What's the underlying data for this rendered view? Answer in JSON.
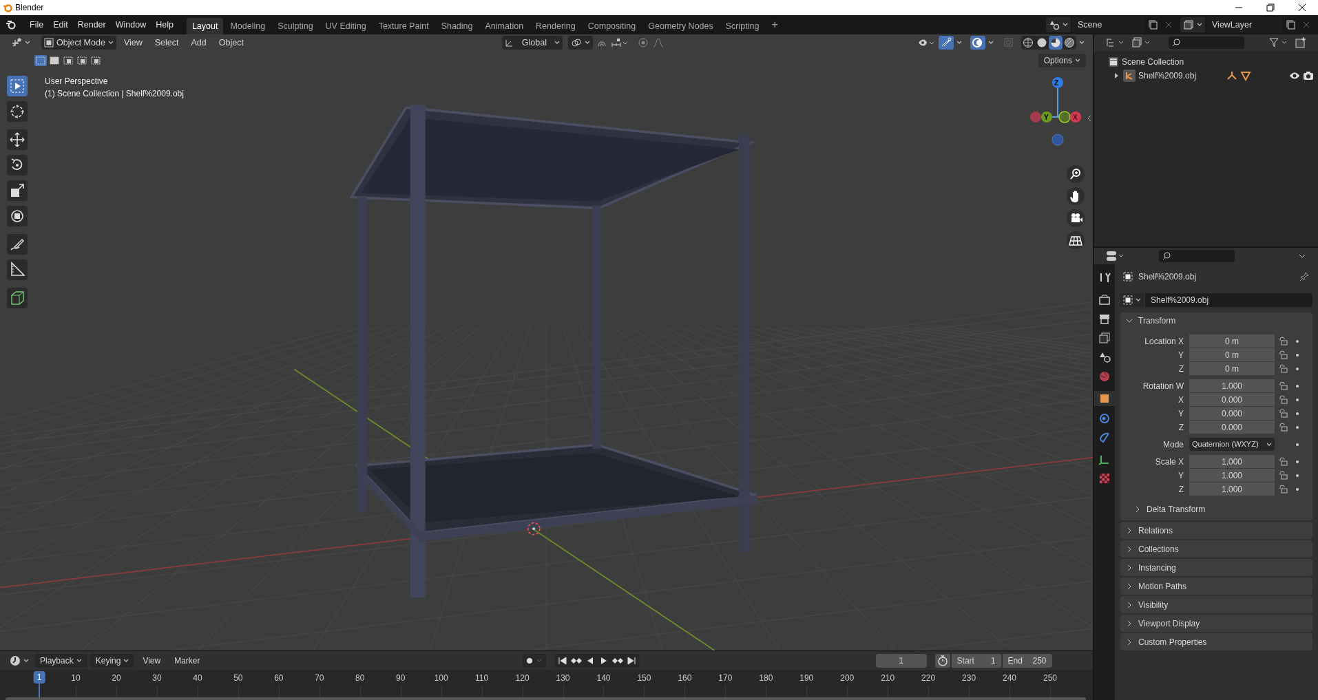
{
  "window": {
    "title": "Blender"
  },
  "menu": [
    "File",
    "Edit",
    "Render",
    "Window",
    "Help"
  ],
  "workspaces": [
    {
      "label": "Layout",
      "selected": true
    },
    {
      "label": "Modeling",
      "selected": false
    },
    {
      "label": "Sculpting",
      "selected": false
    },
    {
      "label": "UV Editing",
      "selected": false
    },
    {
      "label": "Texture Paint",
      "selected": false
    },
    {
      "label": "Shading",
      "selected": false
    },
    {
      "label": "Animation",
      "selected": false
    },
    {
      "label": "Rendering",
      "selected": false
    },
    {
      "label": "Compositing",
      "selected": false
    },
    {
      "label": "Geometry Nodes",
      "selected": false
    },
    {
      "label": "Scripting",
      "selected": false
    }
  ],
  "add_workspace": "+",
  "scene": "Scene",
  "view_layer": "ViewLayer",
  "viewport": {
    "mode": "Object Mode",
    "menus": [
      "View",
      "Select",
      "Add",
      "Object"
    ],
    "orientation": "Global",
    "options": "Options",
    "info": [
      "User Perspective",
      "(1) Scene Collection | Shelf%2009.obj"
    ],
    "tools": [
      {
        "kind": "select",
        "selected": true
      },
      {
        "kind": "cursor",
        "selected": false
      },
      {
        "kind": "move",
        "selected": false
      },
      {
        "kind": "rotate",
        "selected": false
      },
      {
        "kind": "scale",
        "selected": false
      },
      {
        "kind": "transform",
        "selected": false
      },
      {
        "kind": "annotate",
        "selected": false
      },
      {
        "kind": "measure",
        "selected": false
      },
      {
        "kind": "add_cube",
        "selected": false
      }
    ],
    "shading": [
      {
        "kind": "wireframe",
        "selected": false
      },
      {
        "kind": "solid",
        "selected": false
      },
      {
        "kind": "material",
        "selected": true
      },
      {
        "kind": "rendered",
        "selected": false
      }
    ],
    "gizmo_labels": [
      "Z",
      "Y",
      "X"
    ]
  },
  "outliner": {
    "root": "Scene Collection",
    "items": [
      {
        "label": "Shelf%2009.obj",
        "expanded": false
      }
    ]
  },
  "properties": {
    "object_name": "Shelf%2009.obj",
    "data_name": "Shelf%2009.obj",
    "tabs": [
      {
        "kind": "tool",
        "selected": false
      },
      {
        "kind": "render",
        "selected": false
      },
      {
        "kind": "output",
        "selected": false
      },
      {
        "kind": "view_layer",
        "selected": false
      },
      {
        "kind": "scene",
        "selected": false
      },
      {
        "kind": "world",
        "selected": false
      },
      {
        "kind": "object",
        "selected": true
      },
      {
        "kind": "physics",
        "selected": false
      },
      {
        "kind": "constraints",
        "selected": false
      },
      {
        "kind": "data",
        "selected": false
      },
      {
        "kind": "texture",
        "selected": false
      }
    ],
    "transform": {
      "title": "Transform",
      "expanded": true,
      "groups": [
        {
          "kind": "fields",
          "rows": [
            {
              "label": "Location X",
              "value": "0 m"
            },
            {
              "label": "Y",
              "value": "0 m"
            },
            {
              "label": "Z",
              "value": "0 m"
            }
          ]
        },
        {
          "kind": "fields",
          "rows": [
            {
              "label": "Rotation W",
              "value": "1.000"
            },
            {
              "label": "X",
              "value": "0.000"
            },
            {
              "label": "Y",
              "value": "0.000"
            },
            {
              "label": "Z",
              "value": "0.000"
            }
          ]
        },
        {
          "kind": "dropdown",
          "rows": [
            {
              "label": "Mode",
              "value": "Quaternion (WXYZ)"
            }
          ]
        },
        {
          "kind": "fields",
          "rows": [
            {
              "label": "Scale X",
              "value": "1.000"
            },
            {
              "label": "Y",
              "value": "1.000"
            },
            {
              "label": "Z",
              "value": "1.000"
            }
          ]
        }
      ]
    },
    "sections": [
      {
        "label": "Delta Transform",
        "kind": "subpanel",
        "expanded": false
      },
      {
        "label": "Relations",
        "kind": "panel",
        "expanded": false
      },
      {
        "label": "Collections",
        "kind": "panel",
        "expanded": false
      },
      {
        "label": "Instancing",
        "kind": "panel",
        "expanded": false
      },
      {
        "label": "Motion Paths",
        "kind": "panel",
        "expanded": false
      },
      {
        "label": "Visibility",
        "kind": "panel",
        "expanded": false
      },
      {
        "label": "Viewport Display",
        "kind": "panel",
        "expanded": false
      },
      {
        "label": "Custom Properties",
        "kind": "panel",
        "expanded": false
      }
    ]
  },
  "timeline": {
    "menus": [
      "Playback",
      "Keying",
      "View",
      "Marker"
    ],
    "current_frame": "1",
    "start_label": "Start",
    "start": "1",
    "end_label": "End",
    "end": "250",
    "playhead": "1",
    "ticks": [
      "10",
      "20",
      "30",
      "40",
      "50",
      "60",
      "70",
      "80",
      "90",
      "100",
      "110",
      "120",
      "130",
      "140",
      "150",
      "160",
      "170",
      "180",
      "190",
      "200",
      "210",
      "220",
      "230",
      "240",
      "250"
    ]
  }
}
